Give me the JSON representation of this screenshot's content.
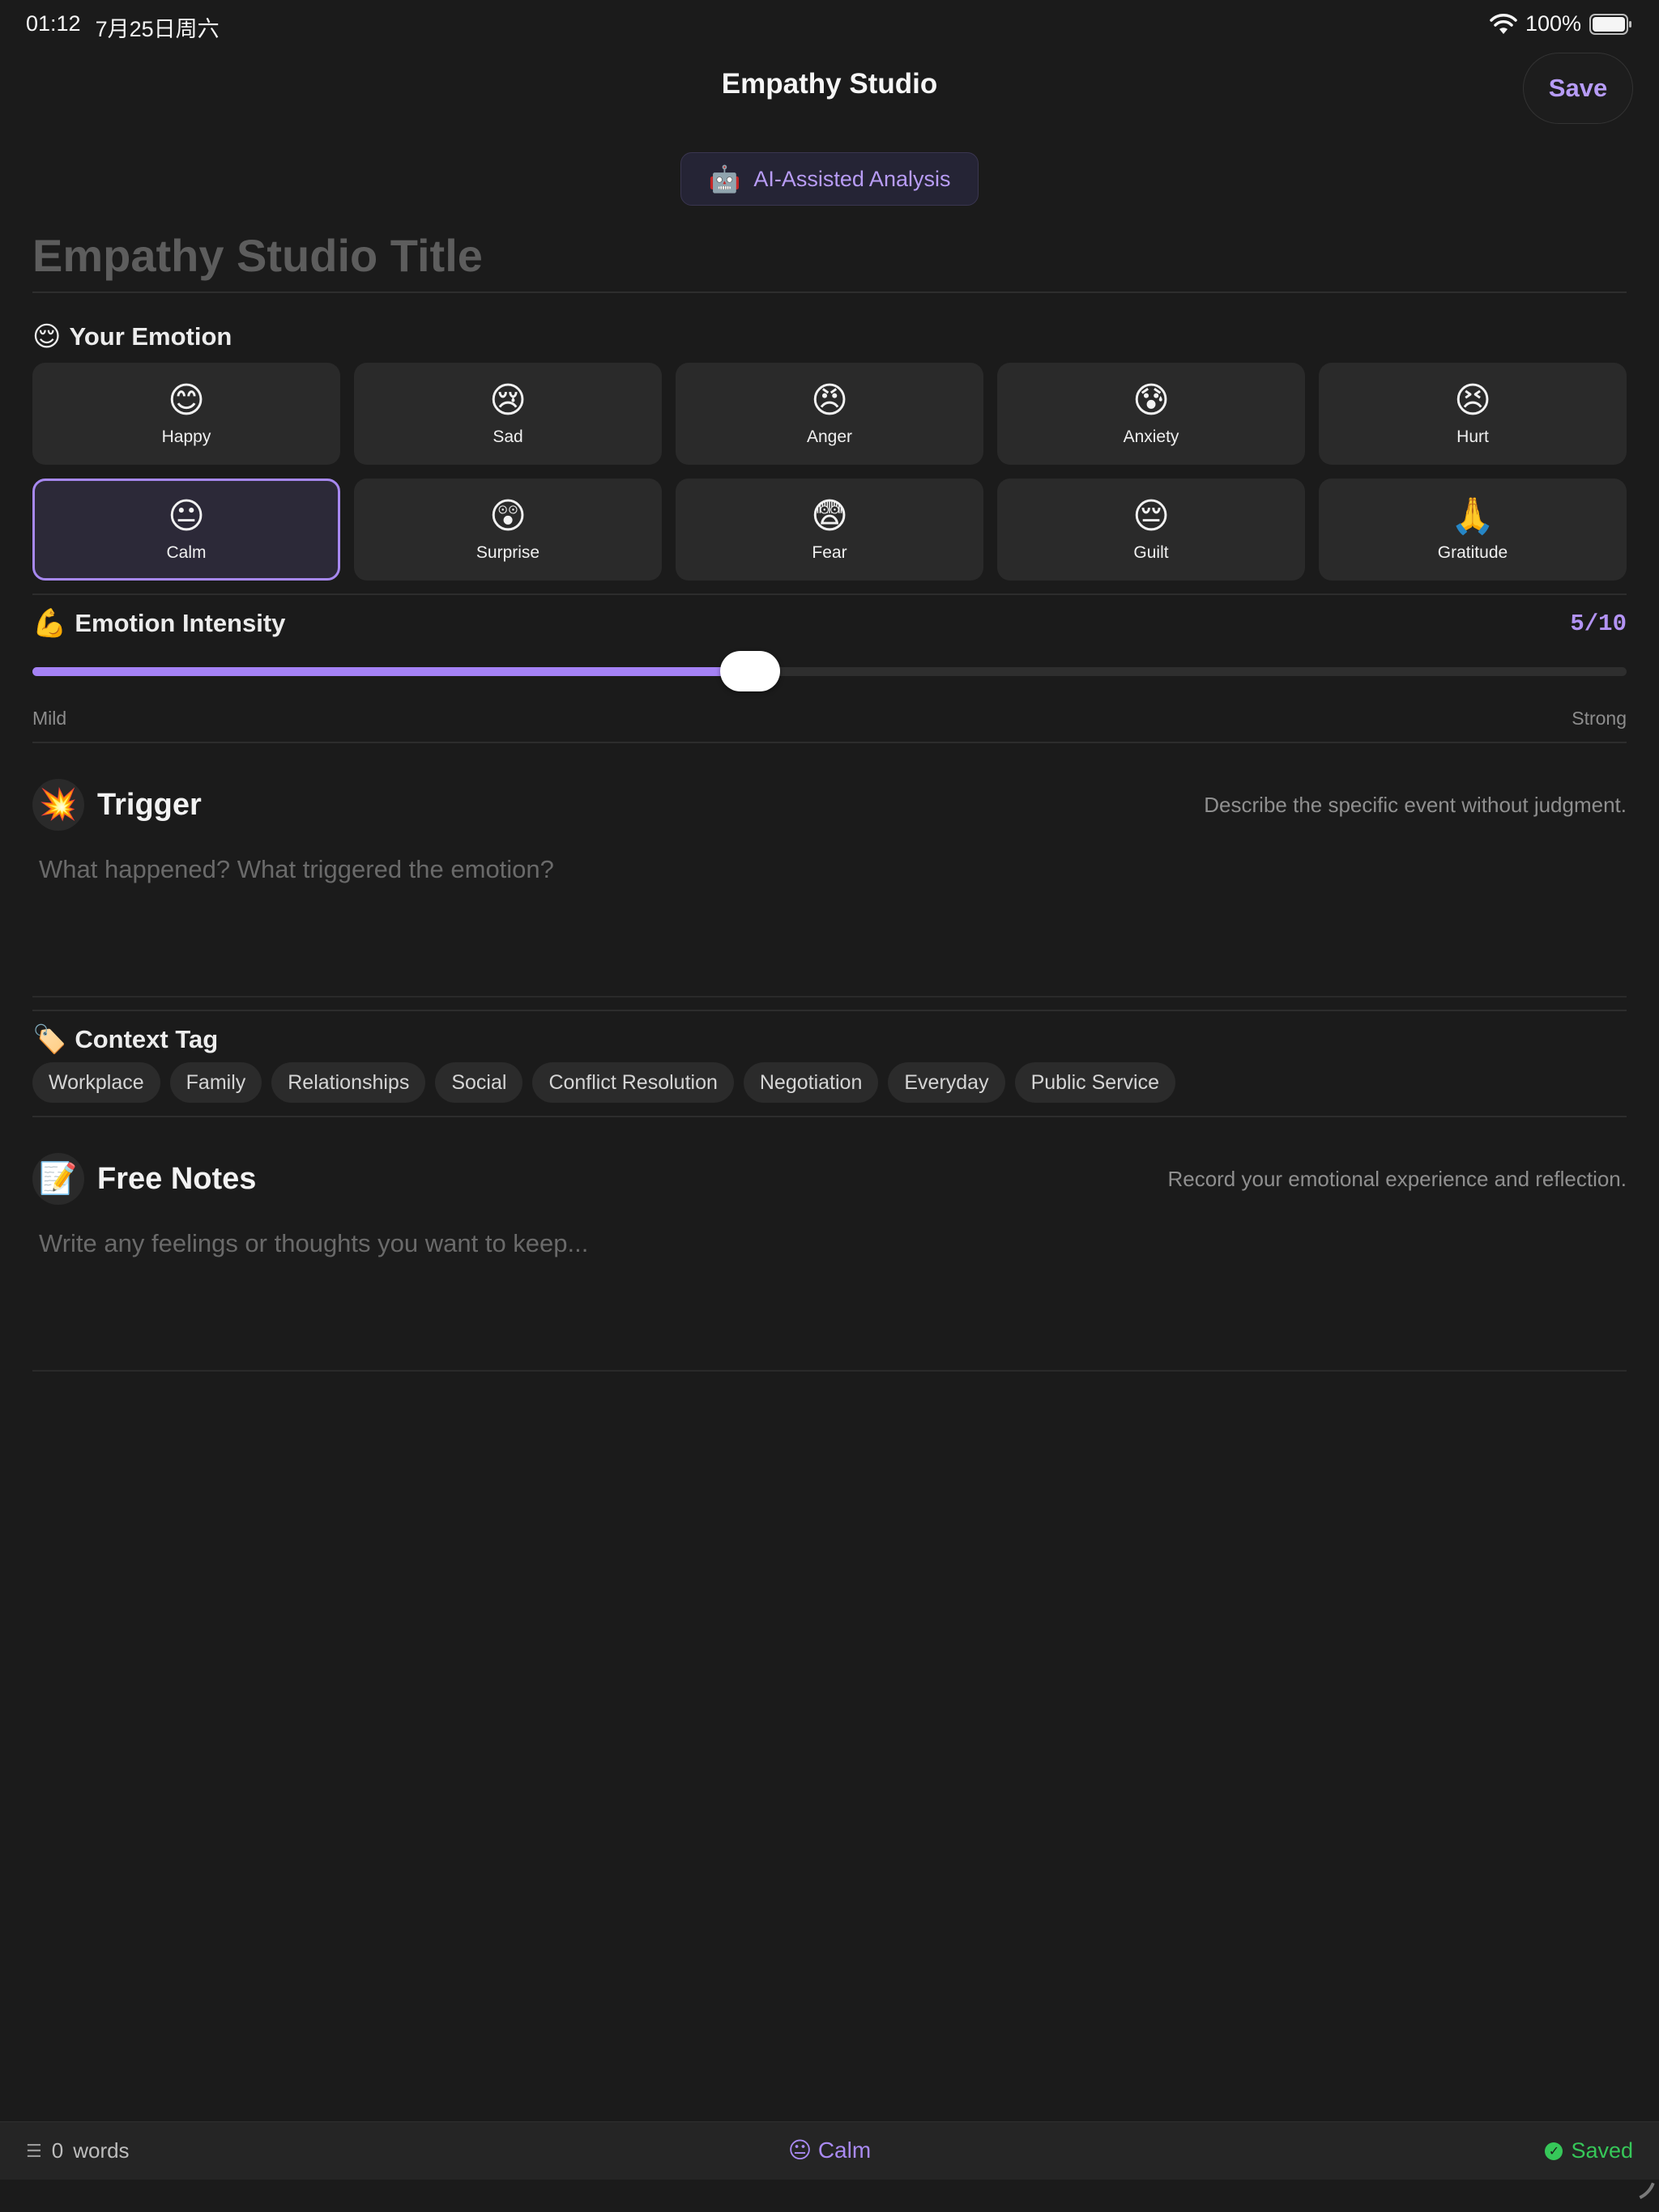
{
  "status_bar": {
    "time": "01:12",
    "date": "7月25日周六",
    "battery": "100%"
  },
  "nav": {
    "title": "Empathy Studio",
    "save_label": "Save"
  },
  "ai_pill": {
    "icon": "🤖",
    "label": "AI-Assisted Analysis"
  },
  "title_field": {
    "placeholder": "Empathy Studio Title",
    "value": ""
  },
  "emotion": {
    "icon": "😌",
    "label": "Your Emotion",
    "selected": "Calm",
    "items": [
      {
        "emoji": "😊",
        "label": "Happy"
      },
      {
        "emoji": "😢",
        "label": "Sad"
      },
      {
        "emoji": "😠",
        "label": "Anger"
      },
      {
        "emoji": "😰",
        "label": "Anxiety"
      },
      {
        "emoji": "😣",
        "label": "Hurt"
      },
      {
        "emoji": "😐",
        "label": "Calm"
      },
      {
        "emoji": "😲",
        "label": "Surprise"
      },
      {
        "emoji": "😨",
        "label": "Fear"
      },
      {
        "emoji": "😔",
        "label": "Guilt"
      },
      {
        "emoji": "🙏",
        "label": "Gratitude"
      }
    ]
  },
  "intensity": {
    "icon": "💪",
    "label": "Emotion Intensity",
    "value_text": "5/10",
    "value": 5,
    "max": 10,
    "min_label": "Mild",
    "max_label": "Strong",
    "accent": "#a582f5"
  },
  "trigger": {
    "icon": "💥",
    "title": "Trigger",
    "hint": "Describe the specific event without judgment.",
    "placeholder": "What happened? What triggered the emotion?"
  },
  "context": {
    "icon": "🏷️",
    "label": "Context Tag",
    "tags": [
      "Workplace",
      "Family",
      "Relationships",
      "Social",
      "Conflict Resolution",
      "Negotiation",
      "Everyday",
      "Public Service"
    ]
  },
  "notes": {
    "icon": "📝",
    "title": "Free Notes",
    "hint": "Record your emotional experience and reflection.",
    "placeholder": "Write any feelings or thoughts you want to keep..."
  },
  "bottom_bar": {
    "word_count": "0",
    "words_label": "words",
    "current_emotion": "😐 Calm",
    "saved_label": "Saved",
    "saved_color": "#36c759"
  }
}
